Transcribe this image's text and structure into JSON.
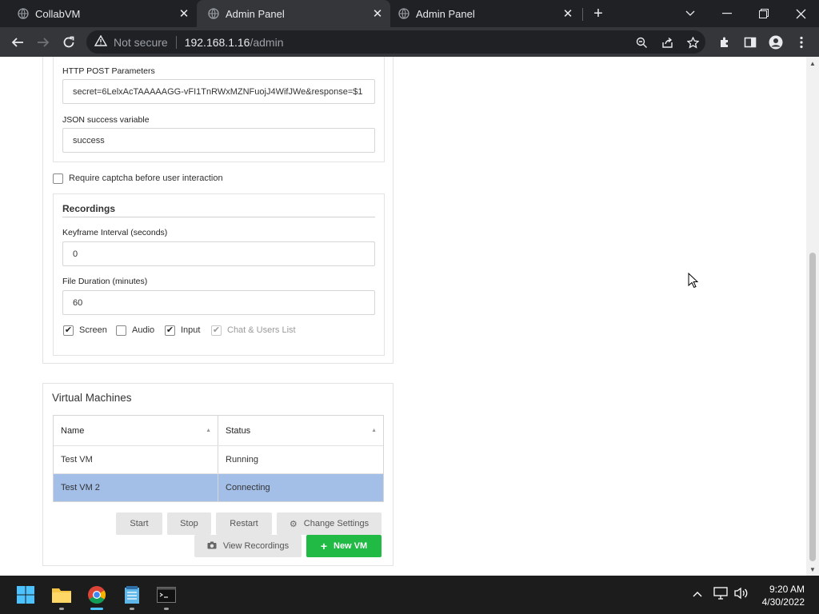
{
  "browser": {
    "tabs": [
      {
        "title": "CollabVM",
        "active": false
      },
      {
        "title": "Admin Panel",
        "active": true
      },
      {
        "title": "Admin Panel",
        "active": false
      }
    ],
    "security_label": "Not secure",
    "url_host": "192.168.1.16",
    "url_path": "/admin"
  },
  "captcha": {
    "post_params_label": "HTTP POST Parameters",
    "post_params_value": "secret=6LelxAcTAAAAAGG-vFI1TnRWxMZNFuojJ4WifJWe&response=$1",
    "json_var_label": "JSON success variable",
    "json_var_value": "success",
    "require_label": "Require captcha before user interaction",
    "require_checked": false
  },
  "recordings": {
    "title": "Recordings",
    "keyframe_label": "Keyframe Interval (seconds)",
    "keyframe_value": "0",
    "duration_label": "File Duration (minutes)",
    "duration_value": "60",
    "options": [
      {
        "label": "Screen",
        "checked": true,
        "disabled": false
      },
      {
        "label": "Audio",
        "checked": false,
        "disabled": false
      },
      {
        "label": "Input",
        "checked": true,
        "disabled": false
      },
      {
        "label": "Chat & Users List",
        "checked": true,
        "disabled": true
      }
    ]
  },
  "vms": {
    "title": "Virtual Machines",
    "columns": [
      "Name",
      "Status"
    ],
    "rows": [
      {
        "name": "Test VM",
        "status": "Running",
        "selected": false
      },
      {
        "name": "Test VM 2",
        "status": "Connecting",
        "selected": true
      }
    ],
    "buttons": {
      "start": "Start",
      "stop": "Stop",
      "restart": "Restart",
      "change_settings": "Change Settings",
      "view_recordings": "View Recordings",
      "new_vm": "New VM"
    }
  },
  "taskbar": {
    "time": "9:20 AM",
    "date": "4/30/2022"
  },
  "colors": {
    "selected_row": "#a3bfe8",
    "new_vm_button": "#21ba45",
    "browser_frame": "#202124"
  }
}
